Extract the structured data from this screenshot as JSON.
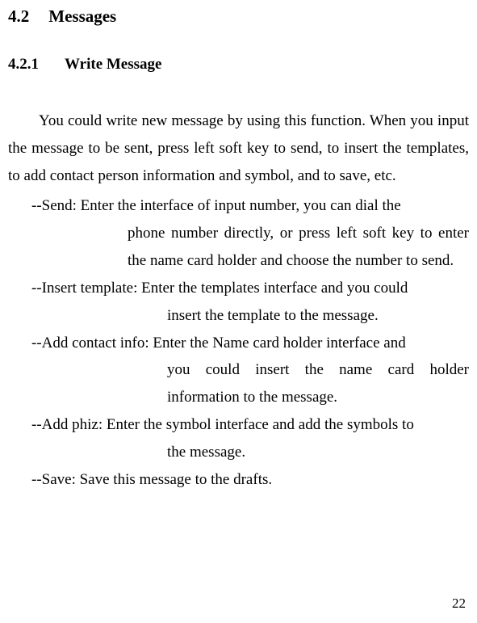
{
  "section": {
    "number": "4.2",
    "title": "Messages"
  },
  "subsection": {
    "number": "4.2.1",
    "title": "Write Message"
  },
  "intro": "You could write new message by using this function. When you input the message to be sent, press left soft key to send, to insert the templates, to add contact person information and symbol, and to save, etc.",
  "items": {
    "send": {
      "first": "--Send: Enter the interface of input number, you can dial the",
      "cont": "phone number directly, or press left soft key to enter the name card holder and choose the number to send."
    },
    "insert": {
      "first": "--Insert template: Enter the templates interface and you could",
      "cont": "insert the template to the message."
    },
    "contact": {
      "first": "--Add contact info: Enter the Name card holder interface and",
      "cont": "you could insert the name card holder information to the message."
    },
    "phiz": {
      "first": "--Add phiz: Enter the symbol interface and add the symbols to",
      "cont": "the message."
    },
    "save": {
      "first": "--Save: Save this message to the drafts."
    }
  },
  "page_number": "22"
}
